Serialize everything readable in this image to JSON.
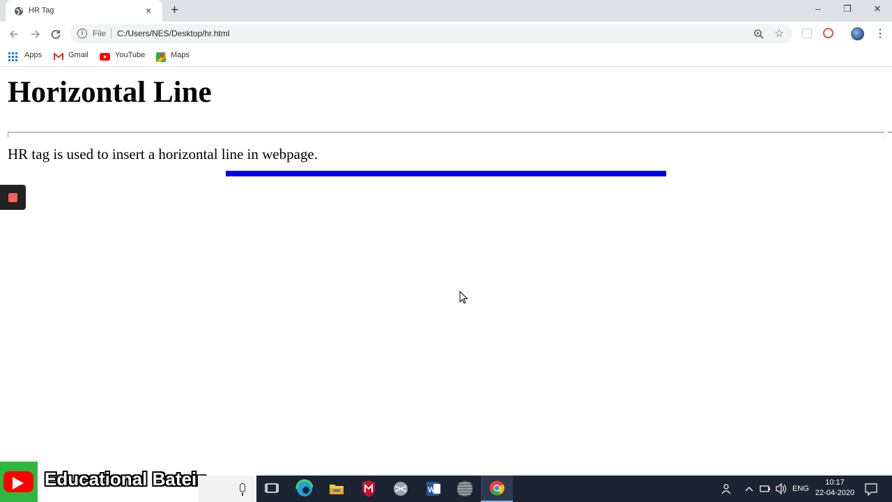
{
  "browser": {
    "tab_title": "HR Tag",
    "tab_close": "×",
    "new_tab": "+",
    "window_controls": {
      "minimize": "–",
      "restore": "❐",
      "close": "✕"
    },
    "scheme_label": "File",
    "url": "C:/Users/NES/Desktop/hr.html",
    "icons": [
      "back-icon",
      "forward-icon",
      "reload-icon",
      "info-icon",
      "zoom-icon",
      "star-icon",
      "profile-avatar",
      "menu-dots-icon"
    ]
  },
  "bookmarks": [
    {
      "label": "Apps",
      "icon": "apps-grid-icon"
    },
    {
      "label": "Gmail",
      "icon": "gmail-icon"
    },
    {
      "label": "YouTube",
      "icon": "youtube-icon"
    },
    {
      "label": "Maps",
      "icon": "maps-icon"
    }
  ],
  "page": {
    "heading": "Horizontal Line",
    "paragraph": "HR tag is used to insert a horizontal line in webpage.",
    "blue_rule_color": "#0000ee"
  },
  "overlay": {
    "channel_name": "Educational Batein"
  },
  "taskbar": {
    "apps": [
      "task-view-icon",
      "edge-icon",
      "file-explorer-icon",
      "mcafee-icon",
      "app-icon",
      "word-icon",
      "globe-app-icon",
      "chrome-icon"
    ],
    "language": "ENG",
    "time": "10:17",
    "date": "22-04-2020"
  }
}
